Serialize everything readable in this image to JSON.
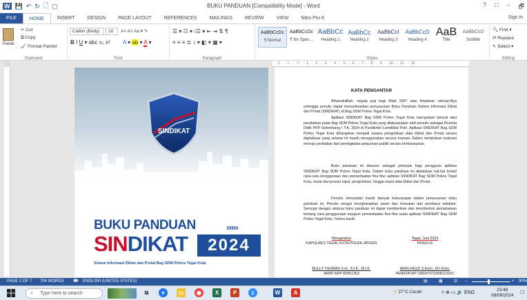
{
  "window": {
    "title": "BUKU PANDUAN [Compatibility Mode] - Word",
    "controls": [
      "?",
      "□",
      "–",
      "🗗"
    ],
    "sign_in": "Sign in"
  },
  "tabs": [
    "FILE",
    "HOME",
    "INSERT",
    "DESIGN",
    "PAGE LAYOUT",
    "REFERENCES",
    "MAILINGS",
    "REVIEW",
    "VIEW",
    "Nitro Pro 9"
  ],
  "ribbon": {
    "clipboard": {
      "paste": "Paste",
      "cut": "Cut",
      "copy": "Copy",
      "format_painter": "Format Painter",
      "label": "Clipboard"
    },
    "font": {
      "family": "Calibri (Body)",
      "size": "10",
      "label": "Font"
    },
    "paragraph": {
      "label": "Paragraph"
    },
    "styles": {
      "label": "Styles",
      "items": [
        {
          "preview": "AaBbCcDc",
          "name": "¶ Normal"
        },
        {
          "preview": "AaBbCcDc",
          "name": "¶ No Spac..."
        },
        {
          "preview": "AaBbCc",
          "name": "Heading 1"
        },
        {
          "preview": "AaBbCc",
          "name": "Heading 2"
        },
        {
          "preview": "AaBbCcI",
          "name": "Heading 3"
        },
        {
          "preview": "AaBbCcD",
          "name": "Heading 4"
        },
        {
          "preview": "AaB",
          "name": "Title"
        },
        {
          "preview": "AaBbCcD",
          "name": "Subtitle"
        }
      ]
    },
    "editing": {
      "find": "Find",
      "replace": "Replace",
      "select": "Select",
      "label": "Editing"
    }
  },
  "ruler_text": "· 2 · · · 1 · · · ▽ · · · 1 · · · 2 · · · 3 · · · 4 · · · 5 · · · 6 · · · 7 · · · 8 · · · 9 · · · 10 · · · 11 · · · 12",
  "cover": {
    "logo_text": "SINDIKAT",
    "title_line1": "BUKU PANDUAN",
    "title_red": "SIN",
    "title_blue": "DIKAT",
    "arrows": "›››››",
    "year": "2024",
    "tagline": "Sistem Informasi Diklat dan Prolat Bag SDM Polres Tegal Kota"
  },
  "preface": {
    "heading": "KATA PENGANTAR",
    "paragraphs": [
      "Alhamdulillah, segala puji bagi Allah SWT atas limpahan rahmat-Nya sehingga penulis dapat menyelesaikan penyusunan Buku Panduan Sistem Informasi Diklat dan Prolat (SINDIKAT) di Bag SDM Polres Tegal Kota.",
      "Aplikasi SINDIKAT Bag SDM Polres Tegal Kota merupakan bentuk aksi perubahan pada Bag SDM Polres Tegal Kota yang dilaksanakan oleh penulis sebagai Peserta Didik PKP Gelombang I T.A. 2024 di Pusdikmin Lemdiklat Polri. Aplikasi SINDIKAT Bag SDM Polres Tegal Kota diharapkan menjadi sarana pengolahan data Diklat dan Prolat secara digitalisasi yang selama ini masih menggunakan secara manual. Dalam melakukan evaluasi menuju perbaikan dan peningkatan pelayanan publik secara berkelanjutan.",
      "Buku panduan ini disusun sebagai petunjuk bagi pengguna aplikasi SINDIKAT Bag SDM Polres Tegal Kota. Dalam buku panduan ini dijelaskan hal-hal terkait cara-cara penggunaan dan pemanfaatan fitur-fitur aplikasi SINDIKAT Bag SDM Polres Tegal Kota, mulai dari proses input, pengolahan, hingga ouput data Diklat dan Prolat.",
      "Penulis menyadari masih banyak kekurangan dalam penyusunan buku panduan ini. Penulis sangat mengharapkan saran dan masukan dari pembaca sekalian. Semoga dengan adanya buku panduan ini dapat memberikan dan membentuk pemahaman tentang cara penggunaan maupun pemanfaatan fitur-fitur pada aplikasi SINDIKAT Bag SDM Polres Tegal Kota. Terima kasih."
    ],
    "left_sig": {
      "line1": "Mengetahui",
      "line2": "KAPOLRES TEGAL KOTA POLDA JATENG",
      "name": "BULLY THOMAS S.H., S.I.K., M.I.K.",
      "nrp": "AKBP NRP 83051363"
    },
    "right_sig": {
      "line1": "Tegal,     Juni 2024",
      "line2": "PENULIS",
      "name": "AMIN FAUZI S.Kom., M.I.Kom.",
      "nrp": "PENATA NIP 198207072008121001"
    }
  },
  "status_bar": {
    "page": "PAGE 2 OF 7",
    "words": "704 WORDS",
    "language": "ENGLISH (UNITED STATES)",
    "zoom": "90%"
  },
  "taskbar": {
    "search_placeholder": "Type here to search",
    "weather": "27°C  Cerah",
    "time": "23:48",
    "date": "08/06/2024"
  },
  "colors": {
    "word_blue": "#2b579a",
    "cover_blue": "#1f4e9a",
    "cover_red": "#c8102e"
  }
}
